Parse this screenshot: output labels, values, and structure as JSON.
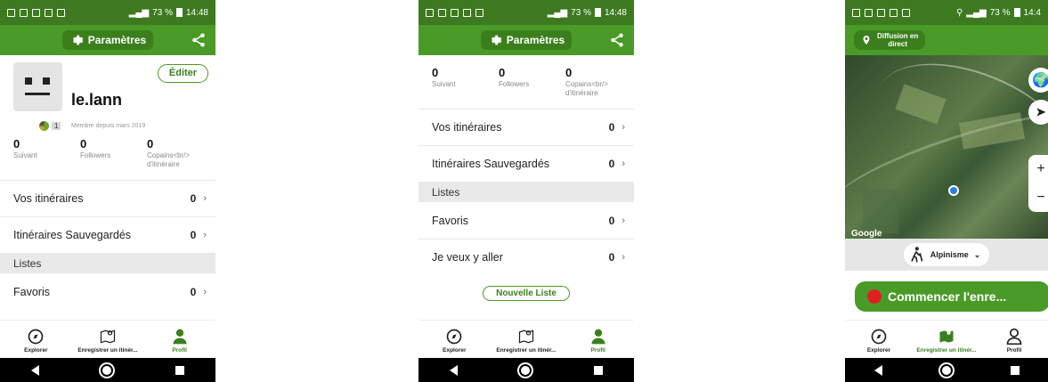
{
  "status_bar": {
    "battery_1": "73 %",
    "time_1": "14:48",
    "battery_2": "73 %",
    "time_2": "14:48",
    "battery_3": "73 %",
    "time_3": "14:4"
  },
  "header": {
    "settings_label": "Paramètres"
  },
  "profile": {
    "edit_label": "Éditer",
    "username": "le.lann",
    "level": "1",
    "member_since": "Membre depuis mars 2019"
  },
  "stats": [
    {
      "value": "0",
      "label": "Suivant"
    },
    {
      "value": "0",
      "label": "Followers"
    },
    {
      "value": "0",
      "label": "Copains<br/> d'itinéraire"
    }
  ],
  "lists": {
    "your_routes": {
      "label": "Vos itinéraires",
      "count": "0"
    },
    "saved_routes": {
      "label": "Itinéraires Sauvegardés",
      "count": "0"
    },
    "section_title": "Listes",
    "favorites": {
      "label": "Favoris",
      "count": "0"
    },
    "want_to_go": {
      "label": "Je veux y aller",
      "count": "0"
    },
    "new_list_label": "Nouvelle Liste"
  },
  "tabs": {
    "explore": "Explorer",
    "record": "Enregistrer un itinér...",
    "profile": "Profil"
  },
  "map_screen": {
    "live_label_1": "Diffusion en",
    "live_label_2": "direct",
    "google_label": "Google",
    "activity_label": "Alpinisme",
    "record_label": "Commencer l'enre...",
    "zoom_in": "+",
    "zoom_out": "−"
  },
  "colors": {
    "brand_green": "#4a9a27",
    "dark_green": "#3d7a1f",
    "record_red": "#e02020"
  }
}
